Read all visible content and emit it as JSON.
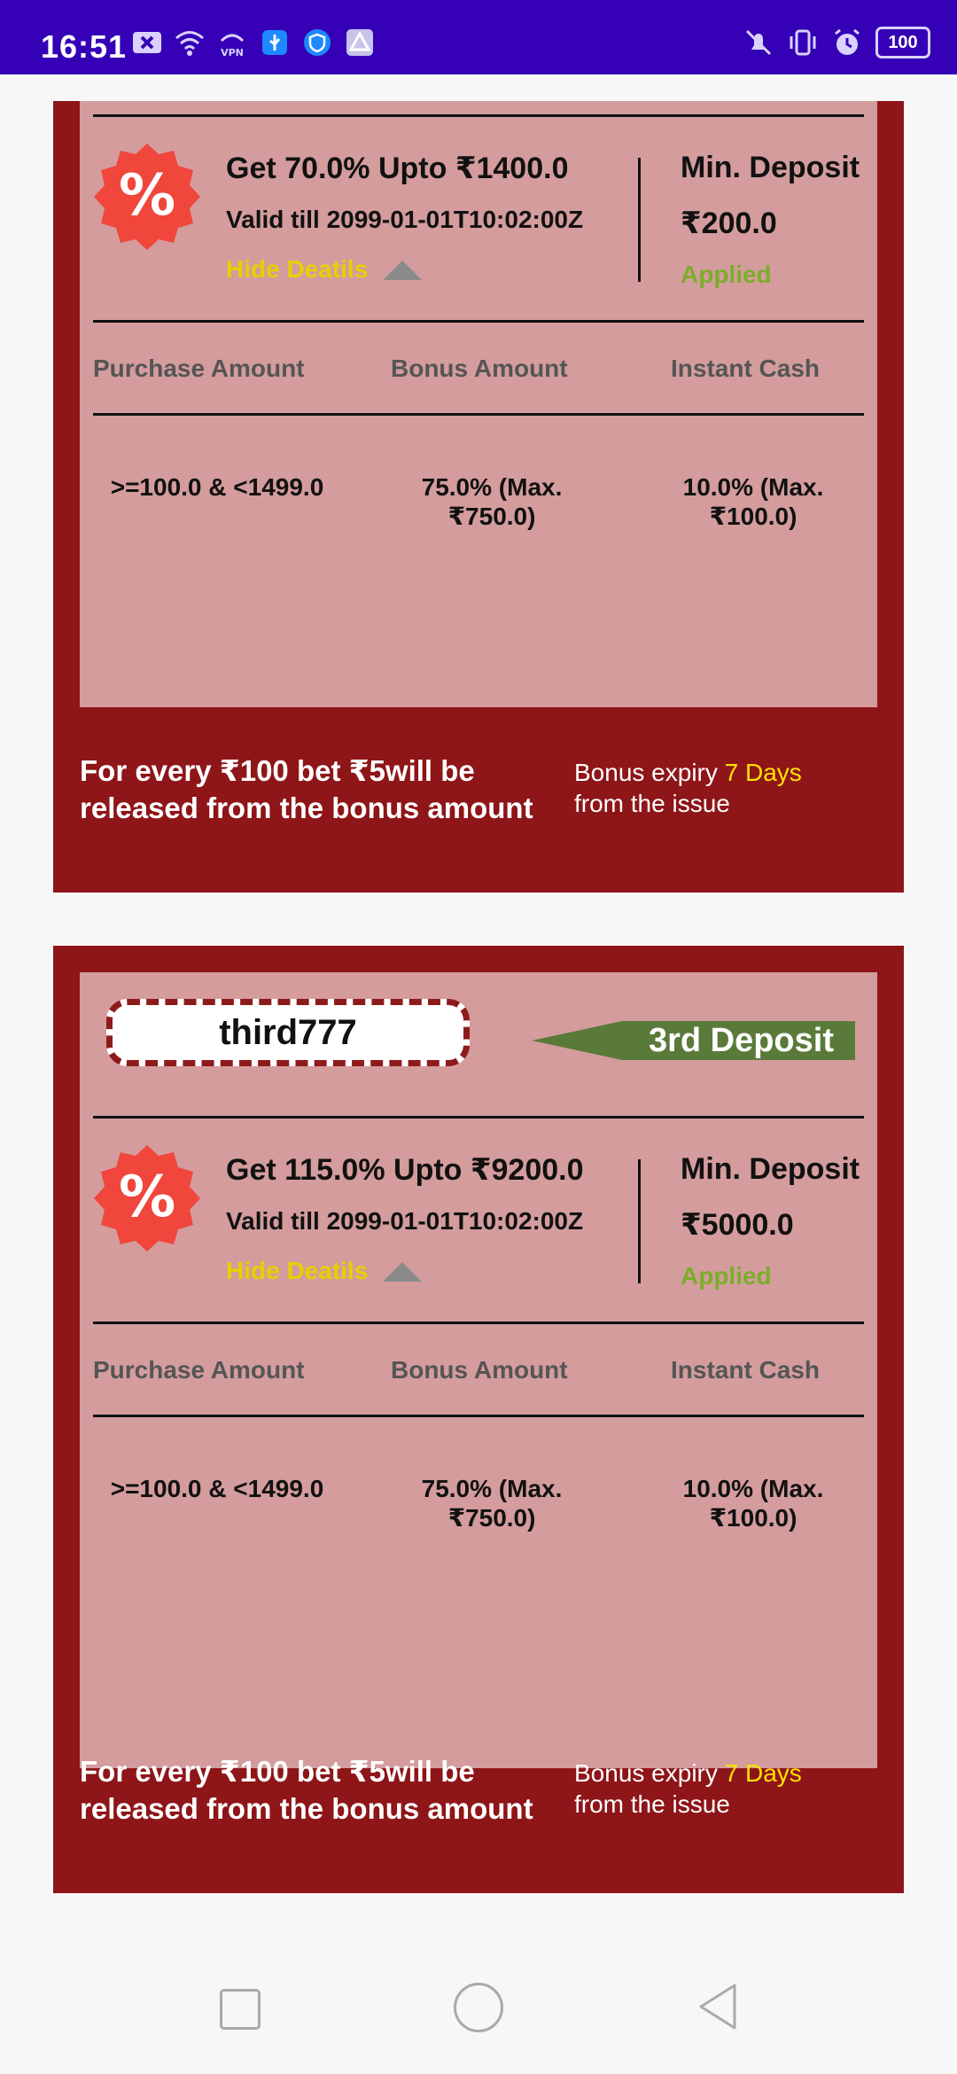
{
  "status_bar": {
    "time": "16:51",
    "battery": "100",
    "left_icons": [
      "close-box-icon",
      "wifi-icon",
      "vpn-icon",
      "usb-icon",
      "shield-icon",
      "drive-icon"
    ],
    "right_icons": [
      "mute-icon",
      "vibrate-icon",
      "alarm-icon",
      "battery-icon"
    ]
  },
  "cards": [
    {
      "offer_title": "Get 70.0% Upto ₹1400.0",
      "valid_till": "Valid till 2099-01-01T10:02:00Z",
      "hide_details": "Hide Deatils",
      "min_deposit_label": "Min. Deposit",
      "min_deposit_value": "₹200.0",
      "status": "Applied",
      "table": {
        "headers": [
          "Purchase Amount",
          "Bonus Amount",
          "Instant Cash"
        ],
        "row": {
          "purchase": ">=100.0 & <1499.0",
          "bonus_line1": "75.0% (Max.",
          "bonus_line2": "₹750.0)",
          "cash_line1": "10.0% (Max.",
          "cash_line2": "₹100.0)"
        }
      },
      "footer_text": "For every ₹100 bet ₹5will be released from the  bonus amount",
      "expiry_prefix": "Bonus expiry ",
      "expiry_days": "7 Days",
      "expiry_suffix": "from the issue"
    },
    {
      "coupon_code": "third777",
      "deposit_tag": "3rd Deposit",
      "offer_title": "Get 115.0% Upto ₹9200.0",
      "valid_till": "Valid till 2099-01-01T10:02:00Z",
      "hide_details": "Hide Deatils",
      "min_deposit_label": "Min. Deposit",
      "min_deposit_value": "₹5000.0",
      "status": "Applied",
      "table": {
        "headers": [
          "Purchase Amount",
          "Bonus Amount",
          "Instant Cash"
        ],
        "row": {
          "purchase": ">=100.0 & <1499.0",
          "bonus_line1": "75.0% (Max.",
          "bonus_line2": "₹750.0)",
          "cash_line1": "10.0% (Max.",
          "cash_line2": "₹100.0)"
        }
      },
      "footer_text": "For every ₹100 bet ₹5will be released from the  bonus amount",
      "expiry_prefix": "Bonus expiry ",
      "expiry_days": "7 Days",
      "expiry_suffix": "from the issue"
    }
  ],
  "colors": {
    "status_bar": "#3500b6",
    "card_outer": "#8e1518",
    "card_inner": "#d49c9d",
    "badge": "#f0463c",
    "applied": "#7cad2a",
    "hide_link": "#e6d000",
    "highlight": "#ffe200",
    "deposit_flag": "#5a7a3a"
  },
  "nav_bar": {
    "icons": [
      "recents-square-icon",
      "home-circle-icon",
      "back-triangle-icon"
    ]
  }
}
